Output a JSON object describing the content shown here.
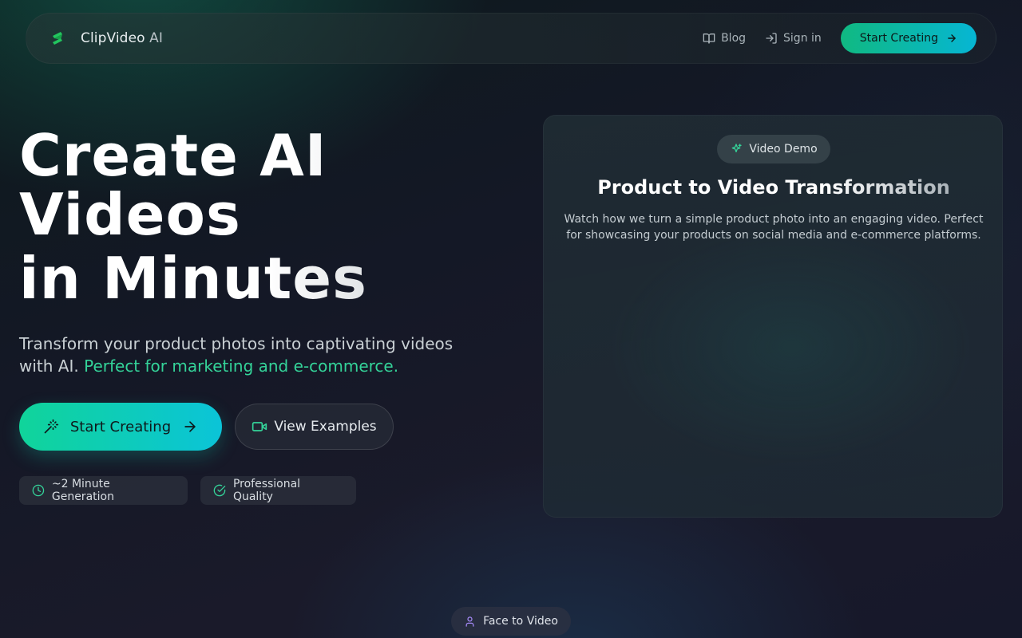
{
  "nav": {
    "brand_name": "ClipVideo",
    "brand_suffix": " AI",
    "links": [
      {
        "label": "Blog",
        "icon": "book-open-icon"
      },
      {
        "label": "Sign in",
        "icon": "log-in-icon"
      }
    ],
    "cta_label": "Start Creating"
  },
  "hero": {
    "title_line1": "Create AI",
    "title_line2": "Videos",
    "title_line3": "in Minutes",
    "subtitle": "Transform your product photos into captivating videos with AI.",
    "subtitle_highlight": "Perfect for marketing and e-commerce.",
    "primary_cta": "Start Creating",
    "secondary_cta": "View Examples",
    "badges": [
      {
        "label": "~2 Minute Generation",
        "icon": "clock-icon"
      },
      {
        "label": "Professional Quality",
        "icon": "check-circle-icon"
      }
    ]
  },
  "demo": {
    "pill_label": "Video Demo",
    "title": "Product to Video Transformation",
    "description": "Watch how we turn a simple product photo into an engaging video. Perfect for showcasing your products on social media and e-commerce platforms."
  },
  "section_pill": {
    "label": "Face to Video",
    "icon": "user-icon"
  },
  "colors": {
    "accent_green": "#10b981",
    "accent_cyan": "#06b6d4",
    "highlight_text": "#34d399",
    "section_icon": "#a78bfa"
  }
}
